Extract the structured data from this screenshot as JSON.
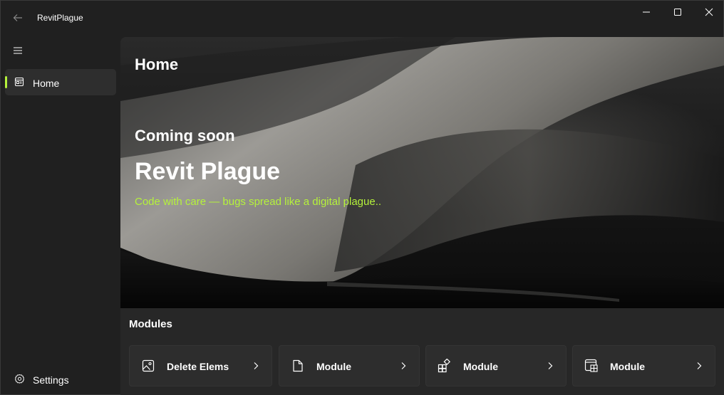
{
  "window": {
    "title": "RevitPlague"
  },
  "sidebar": {
    "items": [
      {
        "label": "Home",
        "icon": "home-icon",
        "selected": true
      },
      {
        "label": "Settings",
        "icon": "gear-icon",
        "selected": false
      }
    ]
  },
  "page": {
    "title": "Home"
  },
  "hero": {
    "subtitle": "Coming soon",
    "title": "Revit Plague",
    "tagline": "Code with care — bugs spread like a digital plague.."
  },
  "modules": {
    "heading": "Modules",
    "cards": [
      {
        "label": "Delete Elems",
        "icon": "image-icon"
      },
      {
        "label": "Module",
        "icon": "document-icon"
      },
      {
        "label": "Module",
        "icon": "apps-add-icon"
      },
      {
        "label": "Module",
        "icon": "window-grid-icon"
      }
    ]
  },
  "colors": {
    "accent": "#b5f23b",
    "background": "#202020",
    "card": "#2d2d2d"
  }
}
